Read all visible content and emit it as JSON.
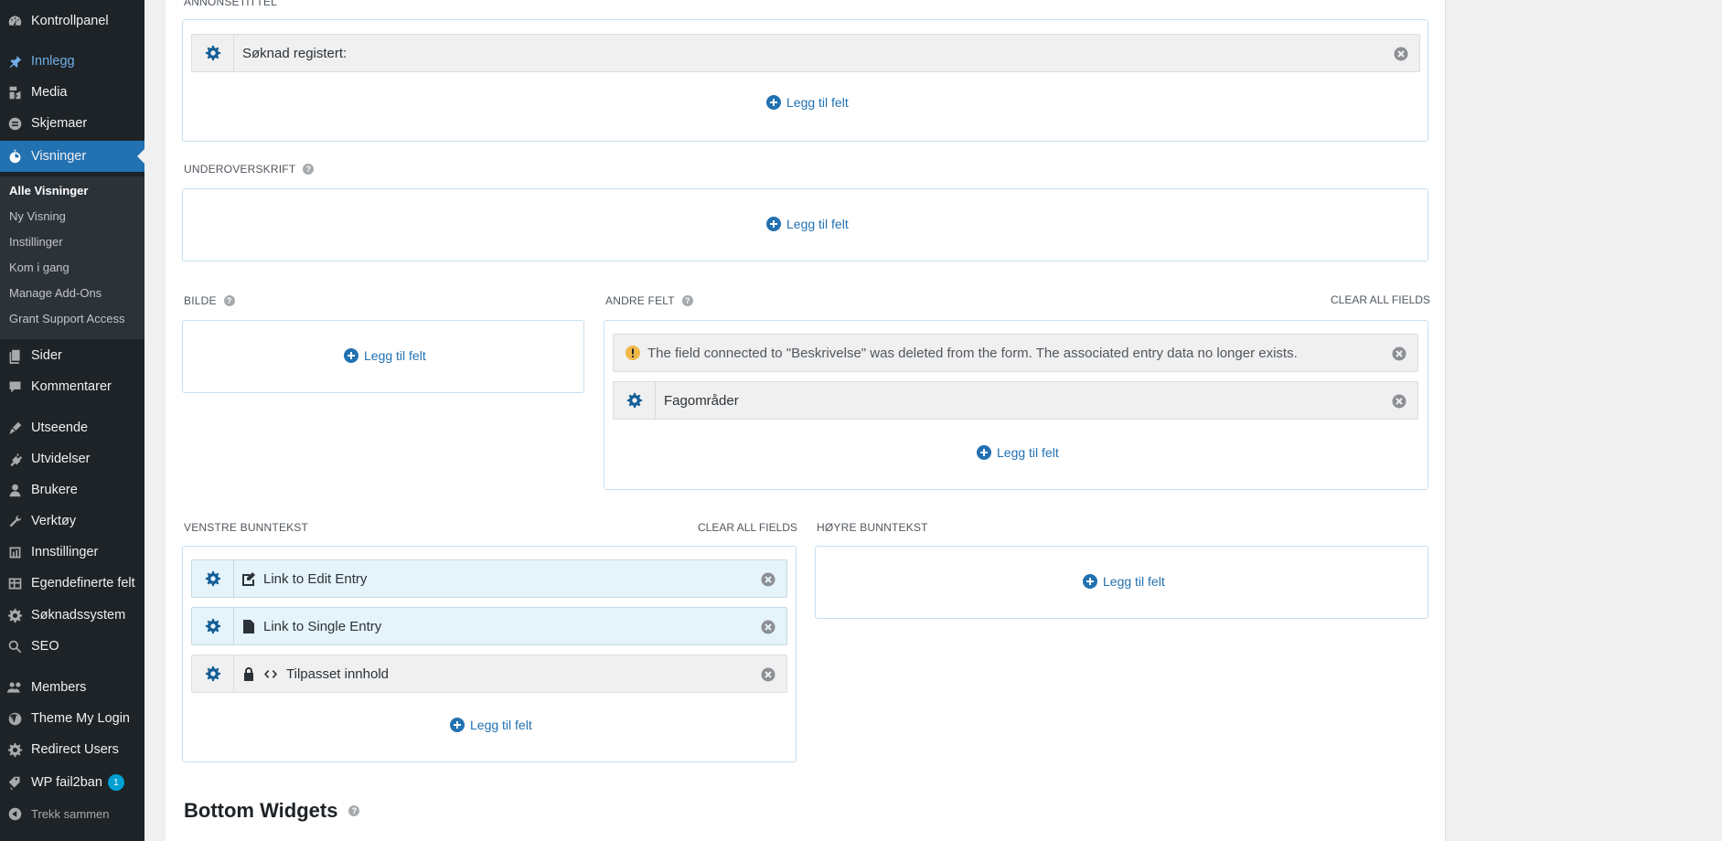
{
  "sidebar": {
    "items": [
      {
        "label": "Kontrollpanel",
        "icon": "dashboard-icon"
      },
      {
        "label": "Innlegg",
        "icon": "pushpin-icon"
      },
      {
        "label": "Media",
        "icon": "media-icon"
      },
      {
        "label": "Skjemaer",
        "icon": "forms-icon"
      },
      {
        "label": "Visninger",
        "icon": "views-icon"
      },
      {
        "label": "Sider",
        "icon": "pages-icon"
      },
      {
        "label": "Kommentarer",
        "icon": "comments-icon"
      },
      {
        "label": "Utseende",
        "icon": "appearance-icon"
      },
      {
        "label": "Utvidelser",
        "icon": "plugins-icon"
      },
      {
        "label": "Brukere",
        "icon": "users-icon"
      },
      {
        "label": "Verktøy",
        "icon": "tools-icon"
      },
      {
        "label": "Innstillinger",
        "icon": "settings-icon"
      },
      {
        "label": "Egendefinerte felt",
        "icon": "table-icon"
      },
      {
        "label": "Søknadssystem",
        "icon": "gear-icon"
      },
      {
        "label": "SEO",
        "icon": "search-icon"
      },
      {
        "label": "Members",
        "icon": "members-icon"
      },
      {
        "label": "Theme My Login",
        "icon": "wordpress-icon"
      },
      {
        "label": "Redirect Users",
        "icon": "gear-icon"
      },
      {
        "label": "WP fail2ban",
        "icon": "tag-icon",
        "badge": "1"
      }
    ],
    "submenu": [
      {
        "label": "Alle Visninger"
      },
      {
        "label": "Ny Visning"
      },
      {
        "label": "Instillinger"
      },
      {
        "label": "Kom i gang"
      },
      {
        "label": "Manage Add-Ons"
      },
      {
        "label": "Grant Support Access"
      }
    ],
    "collapse_label": "Trekk sammen"
  },
  "zones": {
    "title_label": "ANNONSETITTEL",
    "subtitle_label": "UNDEROVERSKRIFT",
    "image_label": "BILDE",
    "other_label": "ANDRE FELT",
    "left_footer_label": "VENSTRE BUNNTEKST",
    "right_footer_label": "HØYRE BUNNTEKST",
    "clear_all": "CLEAR ALL FIELDS",
    "add_field": "Legg til felt",
    "help": "?"
  },
  "fields": {
    "title_field": "Søknad registert:",
    "warning_text": "The field connected to \"Beskrivelse\" was deleted from the form. The associated entry data no longer exists.",
    "fagomrader": "Fagområder",
    "edit_entry": "Link to Edit Entry",
    "single_entry": "Link to Single Entry",
    "custom_content": "Tilpasset innhold"
  },
  "bottom_widgets_title": "Bottom Widgets",
  "colors": {
    "accent": "#2271b1",
    "sidebar": "#1d2327",
    "warning": "#f0b849"
  }
}
